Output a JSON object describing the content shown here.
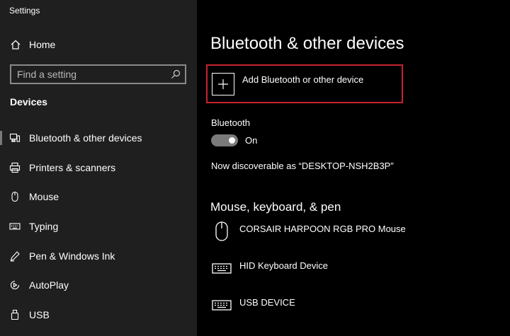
{
  "app": {
    "title": "Settings"
  },
  "sidebar": {
    "home": {
      "label": "Home",
      "icon": "home-icon"
    },
    "search": {
      "placeholder": "Find a setting",
      "value": "",
      "icon": "search-icon"
    },
    "section_title": "Devices",
    "items": [
      {
        "label": "Bluetooth & other devices",
        "icon": "bluetooth-devices-icon",
        "selected": true
      },
      {
        "label": "Printers & scanners",
        "icon": "printer-icon",
        "selected": false
      },
      {
        "label": "Mouse",
        "icon": "mouse-icon",
        "selected": false
      },
      {
        "label": "Typing",
        "icon": "keyboard-icon",
        "selected": false
      },
      {
        "label": "Pen & Windows Ink",
        "icon": "pen-icon",
        "selected": false
      },
      {
        "label": "AutoPlay",
        "icon": "autoplay-icon",
        "selected": false
      },
      {
        "label": "USB",
        "icon": "usb-icon",
        "selected": false
      }
    ]
  },
  "main": {
    "title": "Bluetooth & other devices",
    "add_device": {
      "label": "Add Bluetooth or other device",
      "icon": "plus-icon"
    },
    "bluetooth": {
      "label": "Bluetooth",
      "toggle_state": "On",
      "is_on": true,
      "discoverable_text": "Now discoverable as “DESKTOP-NSH2B3P”"
    },
    "mouse_keyboard_pen": {
      "heading": "Mouse, keyboard, & pen",
      "devices": [
        {
          "name": "CORSAIR HARPOON RGB PRO Mouse",
          "icon": "mouse-icon"
        },
        {
          "name": "HID Keyboard Device",
          "icon": "keyboard-icon"
        },
        {
          "name": "USB DEVICE",
          "icon": "keyboard-icon"
        }
      ]
    }
  },
  "colors": {
    "sidebar_bg": "#1f1f1f",
    "main_bg": "#000000",
    "highlight_border": "#c8232c",
    "toggle_bg": "#7a7a7a"
  }
}
